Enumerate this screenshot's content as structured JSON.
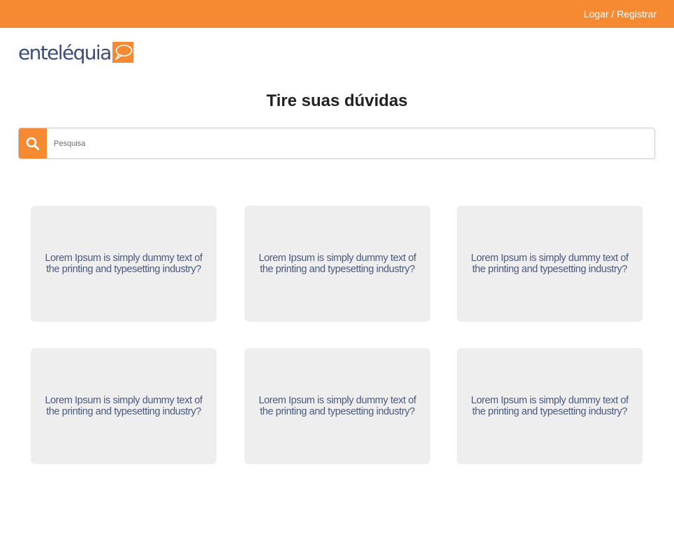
{
  "header": {
    "login_label": "Logar / Registrar"
  },
  "logo": {
    "text": "enteléquia",
    "bubble_icon": "speech-bubble-icon"
  },
  "main": {
    "title": "Tire suas dúvidas",
    "search": {
      "placeholder": "Pesquisa",
      "value": "",
      "icon": "search-icon"
    },
    "questions": [
      {
        "text": "Lorem Ipsum is simply dummy text of the printing and typesetting industry?"
      },
      {
        "text": "Lorem Ipsum is simply dummy text of the printing and typesetting industry?"
      },
      {
        "text": "Lorem Ipsum is simply dummy text of the printing and typesetting industry?"
      },
      {
        "text": "Lorem Ipsum is simply dummy text of the printing and typesetting industry?"
      },
      {
        "text": "Lorem Ipsum is simply dummy text of the printing and typesetting industry?"
      },
      {
        "text": "Lorem Ipsum is simply dummy text of the printing and typesetting industry?"
      }
    ]
  },
  "colors": {
    "brand_orange": "#f68a33",
    "brand_navy": "#3b4d7a",
    "card_bg": "#eeeeee",
    "card_text": "#4a5a7e"
  }
}
